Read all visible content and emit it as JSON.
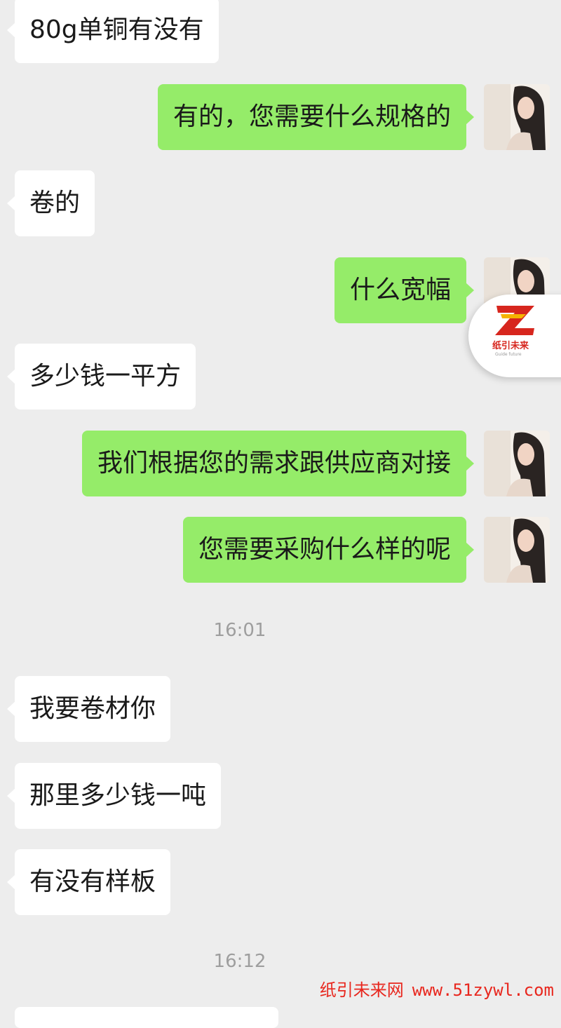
{
  "conversation": {
    "messages": [
      {
        "text": "80g单铜有没有"
      },
      {
        "text": "有的，您需要什么规格的"
      },
      {
        "text": "卷的"
      },
      {
        "text": "什么宽幅"
      },
      {
        "text": "多少钱一平方"
      },
      {
        "text": "我们根据您的需求跟供应商对接"
      },
      {
        "text": "您需要采购什么样的呢"
      },
      {
        "text": "我要卷材你"
      },
      {
        "text": "那里多少钱一吨"
      },
      {
        "text": "有没有样板"
      }
    ],
    "timestamps": [
      "16:01",
      "16:12"
    ]
  },
  "floating_logo": {
    "icon": "z-logo-icon",
    "brand_text": "纸引未来",
    "sub_text": "Guide future"
  },
  "watermark": {
    "site_name": "纸引未来网",
    "url": "www.51zywl.com"
  },
  "colors": {
    "background": "#ededed",
    "incoming_bubble": "#ffffff",
    "outgoing_bubble": "#95ec69",
    "brand_red": "#d7261e",
    "brand_yellow": "#f5b400"
  }
}
